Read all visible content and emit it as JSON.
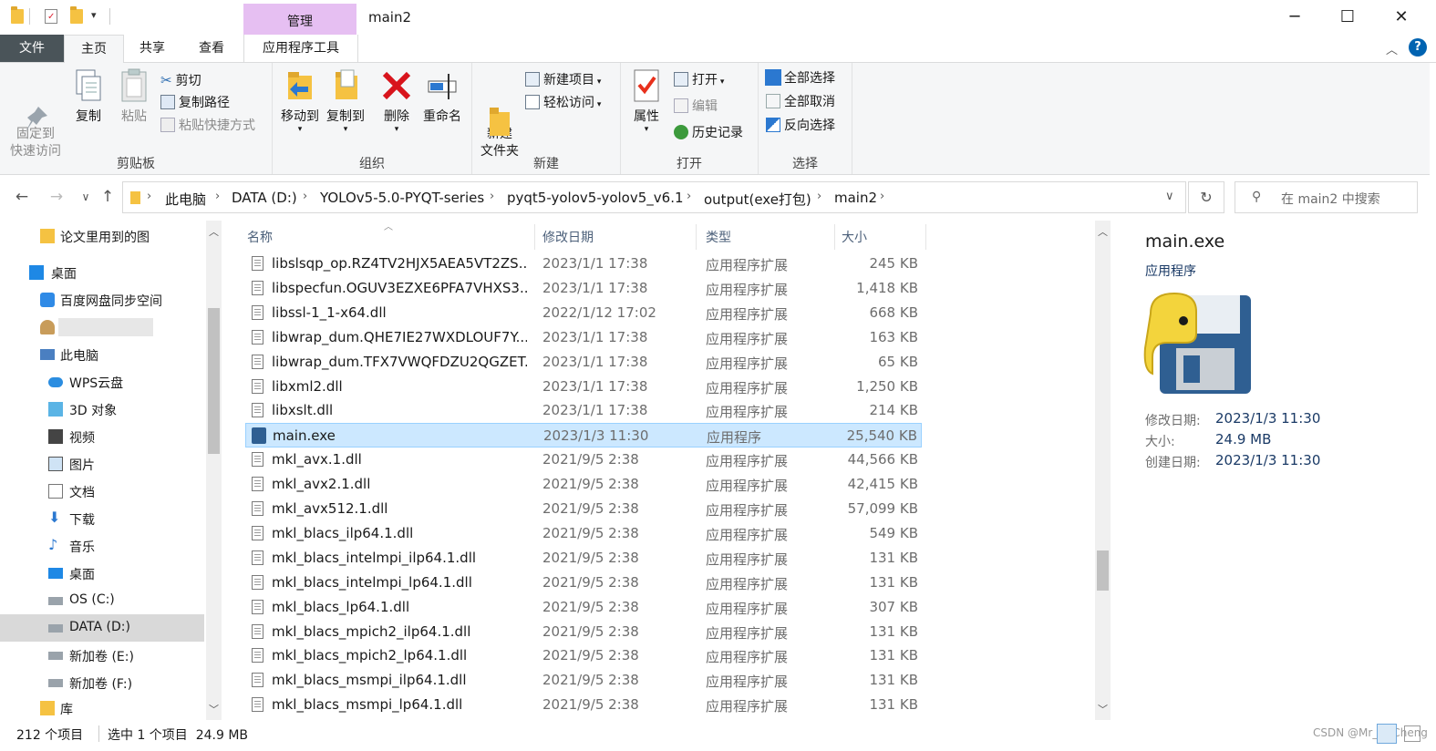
{
  "window": {
    "title": "main2",
    "context_tab_group": "管理",
    "controls": {
      "minimize": "─",
      "maximize": "☐",
      "close": "✕"
    }
  },
  "tabs": {
    "file": "文件",
    "home": "主页",
    "share": "共享",
    "view": "查看",
    "app_tools": "应用程序工具"
  },
  "ribbon": {
    "clipboard": {
      "label": "剪贴板",
      "pin": "固定到\n快速访问",
      "copy": "复制",
      "paste": "粘贴",
      "cut": "剪切",
      "copy_path": "复制路径",
      "paste_shortcut": "粘贴快捷方式"
    },
    "organize": {
      "label": "组织",
      "move_to": "移动到",
      "copy_to": "复制到",
      "delete": "删除",
      "rename": "重命名"
    },
    "new": {
      "label": "新建",
      "new_folder": "新建\n文件夹",
      "new_item": "新建项目",
      "easy_access": "轻松访问"
    },
    "open": {
      "label": "打开",
      "properties": "属性",
      "open": "打开",
      "edit": "编辑",
      "history": "历史记录"
    },
    "select": {
      "label": "选择",
      "select_all": "全部选择",
      "select_none": "全部取消",
      "invert": "反向选择"
    }
  },
  "address": {
    "crumbs": [
      "此电脑",
      "DATA (D:)",
      "YOLOv5-5.0-PYQT-series",
      "pyqt5-yolov5-yolov5_v6.1",
      "output(exe打包)",
      "main2"
    ],
    "search_placeholder": "在 main2 中搜索"
  },
  "nav": {
    "items": [
      {
        "label": "论文里用到的图"
      },
      {
        "label": "桌面"
      },
      {
        "label": "百度网盘同步空间"
      },
      {
        "label": ""
      },
      {
        "label": "此电脑"
      },
      {
        "label": "WPS云盘"
      },
      {
        "label": "3D 对象"
      },
      {
        "label": "视频"
      },
      {
        "label": "图片"
      },
      {
        "label": "文档"
      },
      {
        "label": "下载"
      },
      {
        "label": "音乐"
      },
      {
        "label": "桌面"
      },
      {
        "label": "OS (C:)"
      },
      {
        "label": "DATA (D:)"
      },
      {
        "label": "新加卷 (E:)"
      },
      {
        "label": "新加卷 (F:)"
      },
      {
        "label": "库"
      }
    ]
  },
  "columns": {
    "name": "名称",
    "date": "修改日期",
    "type": "类型",
    "size": "大小"
  },
  "files": [
    {
      "name": "libslsqp_op.RZ4TV2HJX5AEA5VT2ZS...",
      "date": "2023/1/1 17:38",
      "type": "应用程序扩展",
      "size": "245 KB"
    },
    {
      "name": "libspecfun.OGUV3EZXE6PFA7VHXS3...",
      "date": "2023/1/1 17:38",
      "type": "应用程序扩展",
      "size": "1,418 KB"
    },
    {
      "name": "libssl-1_1-x64.dll",
      "date": "2022/1/12 17:02",
      "type": "应用程序扩展",
      "size": "668 KB"
    },
    {
      "name": "libwrap_dum.QHE7IE27WXDLOUF7Y...",
      "date": "2023/1/1 17:38",
      "type": "应用程序扩展",
      "size": "163 KB"
    },
    {
      "name": "libwrap_dum.TFX7VWQFDZU2QGZET...",
      "date": "2023/1/1 17:38",
      "type": "应用程序扩展",
      "size": "65 KB"
    },
    {
      "name": "libxml2.dll",
      "date": "2023/1/1 17:38",
      "type": "应用程序扩展",
      "size": "1,250 KB"
    },
    {
      "name": "libxslt.dll",
      "date": "2023/1/1 17:38",
      "type": "应用程序扩展",
      "size": "214 KB"
    },
    {
      "name": "main.exe",
      "date": "2023/1/3 11:30",
      "type": "应用程序",
      "size": "25,540 KB",
      "selected": true
    },
    {
      "name": "mkl_avx.1.dll",
      "date": "2021/9/5 2:38",
      "type": "应用程序扩展",
      "size": "44,566 KB"
    },
    {
      "name": "mkl_avx2.1.dll",
      "date": "2021/9/5 2:38",
      "type": "应用程序扩展",
      "size": "42,415 KB"
    },
    {
      "name": "mkl_avx512.1.dll",
      "date": "2021/9/5 2:38",
      "type": "应用程序扩展",
      "size": "57,099 KB"
    },
    {
      "name": "mkl_blacs_ilp64.1.dll",
      "date": "2021/9/5 2:38",
      "type": "应用程序扩展",
      "size": "549 KB"
    },
    {
      "name": "mkl_blacs_intelmpi_ilp64.1.dll",
      "date": "2021/9/5 2:38",
      "type": "应用程序扩展",
      "size": "131 KB"
    },
    {
      "name": "mkl_blacs_intelmpi_lp64.1.dll",
      "date": "2021/9/5 2:38",
      "type": "应用程序扩展",
      "size": "131 KB"
    },
    {
      "name": "mkl_blacs_lp64.1.dll",
      "date": "2021/9/5 2:38",
      "type": "应用程序扩展",
      "size": "307 KB"
    },
    {
      "name": "mkl_blacs_mpich2_ilp64.1.dll",
      "date": "2021/9/5 2:38",
      "type": "应用程序扩展",
      "size": "131 KB"
    },
    {
      "name": "mkl_blacs_mpich2_lp64.1.dll",
      "date": "2021/9/5 2:38",
      "type": "应用程序扩展",
      "size": "131 KB"
    },
    {
      "name": "mkl_blacs_msmpi_ilp64.1.dll",
      "date": "2021/9/5 2:38",
      "type": "应用程序扩展",
      "size": "131 KB"
    },
    {
      "name": "mkl_blacs_msmpi_lp64.1.dll",
      "date": "2021/9/5 2:38",
      "type": "应用程序扩展",
      "size": "131 KB"
    }
  ],
  "details": {
    "filename": "main.exe",
    "kind": "应用程序",
    "fields": [
      {
        "label": "修改日期:",
        "value": "2023/1/3 11:30"
      },
      {
        "label": "大小:",
        "value": "24.9 MB"
      },
      {
        "label": "创建日期:",
        "value": "2023/1/3 11:30"
      }
    ]
  },
  "status": {
    "count": "212 个项目",
    "selection": "选中 1 个项目  24.9 MB"
  },
  "watermark": "CSDN @Mr_Li_Cheng",
  "colors": {
    "selected_row": "#cce8ff",
    "context_tab": "#e6bff2",
    "file_tab": "#4a5459",
    "help": "#0063b1"
  }
}
